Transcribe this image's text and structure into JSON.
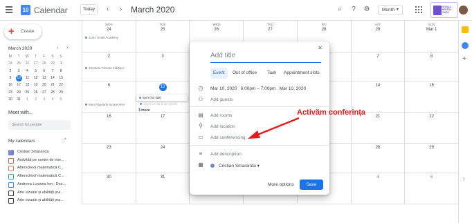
{
  "header": {
    "app_title": "Calendar",
    "logo_num": "10",
    "today_label": "Today",
    "month_title": "March 2020",
    "view_label": "Month",
    "school_logo_text": "ȘCOALA PENTRU VIAȚĂ"
  },
  "sidebar": {
    "create_label": "Create",
    "mini_title": "March 2020",
    "mini_days": [
      "M",
      "T",
      "W",
      "T",
      "F",
      "S",
      "S"
    ],
    "mini_rows": [
      [
        "24",
        "25",
        "26",
        "27",
        "28",
        "29",
        "1"
      ],
      [
        "2",
        "3",
        "4",
        "5",
        "6",
        "7",
        "8"
      ],
      [
        "9",
        "10",
        "11",
        "12",
        "13",
        "14",
        "15"
      ],
      [
        "16",
        "17",
        "18",
        "19",
        "20",
        "21",
        "22"
      ],
      [
        "23",
        "24",
        "25",
        "26",
        "27",
        "28",
        "29"
      ],
      [
        "30",
        "31",
        "1",
        "2",
        "3",
        "4",
        "5"
      ]
    ],
    "meet_title": "Meet with...",
    "search_placeholder": "Search for people",
    "my_calendars_title": "My calendars",
    "calendars": [
      {
        "name": "Cristian Smaranda",
        "color": "#7986cb",
        "checked": true
      },
      {
        "name": "Activități pe centre de inte...",
        "color": "#b0725c",
        "checked": false
      },
      {
        "name": "Afterschool matematică C...",
        "color": "#d0826b",
        "checked": false
      },
      {
        "name": "Afterschool matematică C...",
        "color": "#33b679",
        "checked": false
      },
      {
        "name": "Andreea Luciana Ion - Dez...",
        "color": "#4285f4",
        "checked": false
      },
      {
        "name": "Arte vizuale și abilități pra...",
        "color": "#3c4043",
        "checked": false
      },
      {
        "name": "Arte vizuale și abilități pra...",
        "color": "#3c4043",
        "checked": false
      }
    ]
  },
  "grid": {
    "dow": [
      "MON",
      "TUE",
      "WED",
      "THU",
      "FRI",
      "SAT",
      "SUN"
    ],
    "weeks": [
      [
        "24",
        "25",
        "26",
        "27",
        "28",
        "29",
        "Mar 1"
      ],
      [
        "2",
        "3",
        "4",
        "5",
        "6",
        "7",
        "8"
      ],
      [
        "9",
        "10",
        "11",
        "12",
        "13",
        "14",
        "15"
      ],
      [
        "16",
        "17",
        "18",
        "19",
        "20",
        "21",
        "22"
      ],
      [
        "23",
        "24",
        "25",
        "26",
        "27",
        "28",
        "29"
      ],
      [
        "30",
        "31",
        "1",
        "2",
        "3",
        "4",
        "5"
      ]
    ],
    "events": {
      "mon_w1": "11am Small Academy",
      "mon_w2": "10:30am Filmare mărțișor",
      "mon_w3": "9am Rapoarte lunare ANA",
      "tue_w3_chip": "6pm (No title)",
      "tue_w3_faded": "10am Lecția la geografie",
      "tue_w3_more": "3 more"
    }
  },
  "dialog": {
    "title_placeholder": "Add title",
    "tabs": [
      "Event",
      "Out of office",
      "Task",
      "Appointment slots"
    ],
    "date_start": "Mar 10, 2020",
    "time_start": "6:00pm",
    "dash": "–",
    "time_end": "7:00pm",
    "date_end": "Mar 10, 2020",
    "add_guests": "Add guests",
    "add_rooms": "Add rooms",
    "add_location": "Add location",
    "add_conferencing": "Add conferencing",
    "add_description": "Add description",
    "calendar_name": "Cristian Smaranda",
    "more_options": "More options",
    "save": "Save"
  },
  "annotation": {
    "text": "Activăm conferința",
    "color": "#e81919"
  }
}
